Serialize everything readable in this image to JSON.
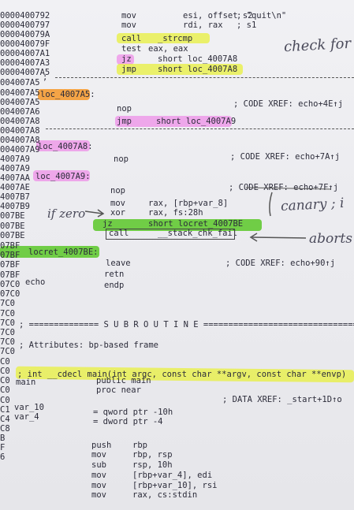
{
  "addr": [
    "0000400792",
    "0000400797",
    "000040079A",
    "000040079F",
    "00004007A1",
    "00004007A3",
    "00004007A5",
    "004007A5",
    "004007A5",
    "004007A5",
    "004007A6",
    "004007A8",
    "004007A8",
    "004007A8",
    "004007A9",
    "4007A9",
    "4007A9",
    "4007AA",
    "4007AE",
    "4007B7",
    "4007B9",
    "007BE",
    "007BE",
    "007BE",
    "07BF",
    "07BF",
    "07BF",
    "07BF",
    "07C0",
    "07C0",
    "7C0",
    "7C0",
    "7C0",
    "7C0",
    "7C0",
    "7C0",
    "C0",
    "C0",
    "C0",
    "C0",
    "C0",
    "C1",
    "C4",
    "C8",
    "B",
    "F",
    "6"
  ],
  "ins": [
    {
      "m": "mov",
      "a": "esi, offset s2",
      "c": "; \"quit\\n\""
    },
    {
      "m": "mov",
      "a": "rdi, rax",
      "c": "; s1"
    },
    {
      "m": "call",
      "a": "_strcmp",
      "c": ""
    },
    {
      "m": "test",
      "a": "eax, eax",
      "c": ""
    },
    {
      "m": "jz",
      "a": "short loc_4007A8",
      "c": ""
    },
    {
      "m": "jmp",
      "a": "short loc_4007A8",
      "c": ""
    },
    {
      "m": "nop",
      "a": "",
      "c": ""
    },
    {
      "m": "jmp",
      "a": "short loc_4007A9",
      "c": ""
    },
    {
      "m": "nop",
      "a": "",
      "c": ""
    },
    {
      "m": "nop",
      "a": "",
      "c": ""
    },
    {
      "m": "mov",
      "a": "rax, [rbp+var_8]",
      "c": ""
    },
    {
      "m": "xor",
      "a": "rax, fs:28h",
      "c": ""
    },
    {
      "m": "jz",
      "a": "short locret_4007BE",
      "c": ""
    },
    {
      "m": "call",
      "a": "__stack_chk_fail",
      "c": ""
    },
    {
      "m": "leave",
      "a": "",
      "c": ""
    },
    {
      "m": "retn",
      "a": "",
      "c": ""
    },
    {
      "m": "endp",
      "a": "",
      "c": ""
    },
    {
      "m": "public main",
      "a": "",
      "c": ""
    },
    {
      "m": "proc near",
      "a": "",
      "c": ""
    },
    {
      "m": "= qword ptr -10h",
      "a": "",
      "c": ""
    },
    {
      "m": "= dword ptr -4",
      "a": "",
      "c": ""
    },
    {
      "m": "push",
      "a": "rbp",
      "c": ""
    },
    {
      "m": "mov",
      "a": "rbp, rsp",
      "c": ""
    },
    {
      "m": "sub",
      "a": "rsp, 10h",
      "c": ""
    },
    {
      "m": "mov",
      "a": "[rbp+var_4], edi",
      "c": ""
    },
    {
      "m": "mov",
      "a": "[rbp+var_10], rsi",
      "c": ""
    },
    {
      "m": "mov",
      "a": "rax, cs:stdin",
      "c": ""
    }
  ],
  "labels": {
    "l1": "loc_4007A5:",
    "l2": "loc_4007A8:",
    "l3": "loc_4007A9:",
    "l4": "locret_4007BE:",
    "echo": "echo",
    "main": "main",
    "v10": "var_10",
    "v4": "var_4"
  },
  "xref": {
    "x1": "; CODE XREF: echo+4E↑j",
    "x2": "; CODE XREF: echo+7A↑j",
    "x3": "; CODE XREF: echo+7F↑j",
    "x4": "; CODE XREF: echo+90↑j",
    "x5": "; DATA XREF: _start+1D↑o"
  },
  "sub": {
    "banner": "; ============== S U B R O U T I N E =======================================",
    "attr": "; Attributes: bp-based frame",
    "proto": "; int __cdecl main(int argc, const char **argv, const char **envp)",
    "semi": ";"
  },
  "notes": {
    "check": "check for",
    "zero": "if zero",
    "canary": "canary ; i",
    "aborts": "aborts"
  }
}
